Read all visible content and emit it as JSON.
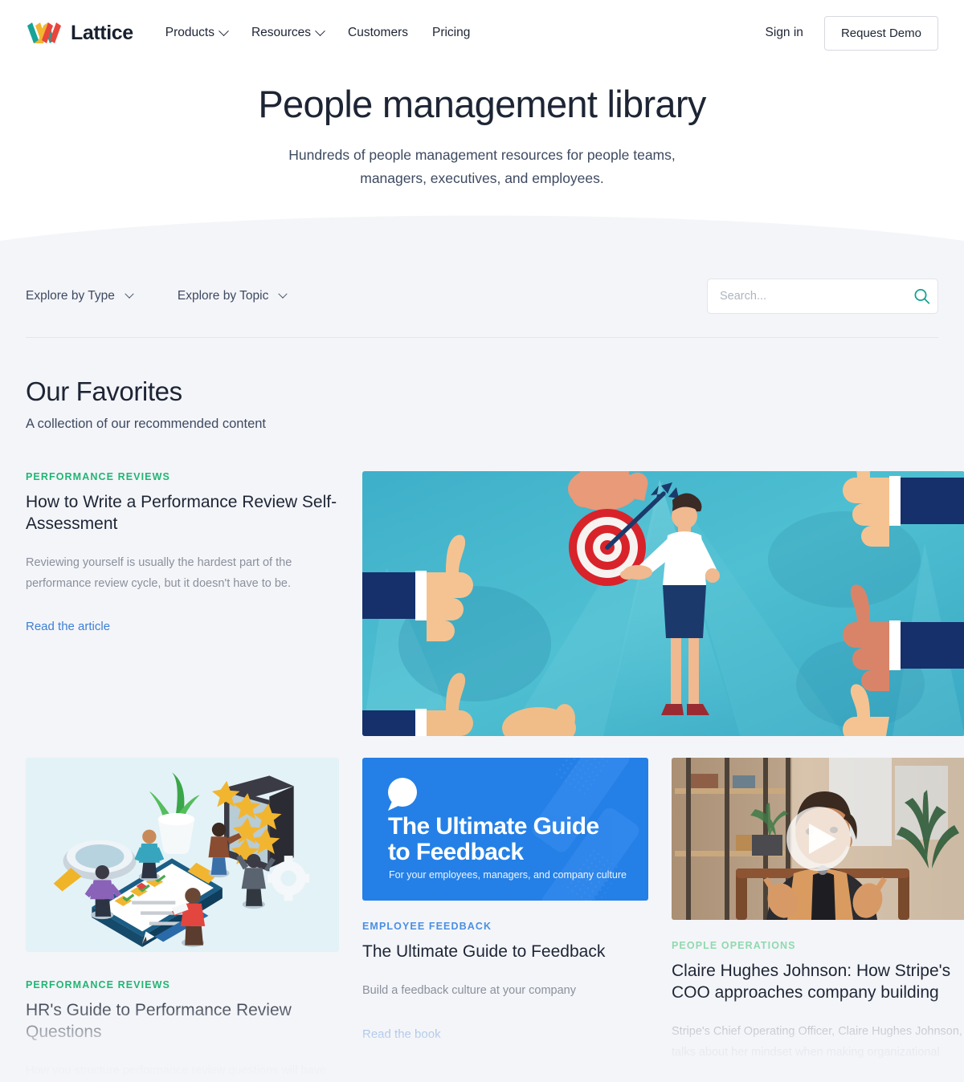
{
  "brand": {
    "name": "Lattice",
    "logo_icon": "lattice-logo-icon"
  },
  "nav": {
    "items": [
      {
        "label": "Products",
        "has_caret": true
      },
      {
        "label": "Resources",
        "has_caret": true
      },
      {
        "label": "Customers",
        "has_caret": false
      },
      {
        "label": "Pricing",
        "has_caret": false
      }
    ],
    "sign_in": "Sign in",
    "request_demo": "Request Demo"
  },
  "hero": {
    "title": "People management library",
    "subtitle": "Hundreds of people management resources for people teams, managers, executives, and employees."
  },
  "filters": {
    "type": {
      "label": "Explore by Type",
      "icon": "chevron-down-icon"
    },
    "topic": {
      "label": "Explore by Topic",
      "icon": "chevron-down-icon"
    }
  },
  "search": {
    "placeholder": "Search...",
    "value": "",
    "icon": "search-icon",
    "icon_color": "#16a293"
  },
  "section": {
    "title": "Our Favorites",
    "subtitle": "A collection of our recommended content"
  },
  "colors": {
    "page_background": "#f4f5f9",
    "header_background": "#ffffff",
    "text_primary": "#1d2535",
    "text_muted": "#8a909c",
    "link_blue": "#3d7fd4",
    "eyebrow_green": "#22b573",
    "eyebrow_blue": "#4a90e2",
    "eyebrow_mint": "#8fd9ae",
    "teal_accent": "#16a293",
    "book_card_blue": "#2480e6"
  },
  "cards": {
    "featured": {
      "eyebrow": "PERFORMANCE REVIEWS",
      "eyebrow_color": "#22b573",
      "title": "How to Write a Performance Review Self-Assessment",
      "description": "Reviewing yourself is usually the hardest part of the performance review cycle, but it doesn't have to be.",
      "link": "Read the article",
      "image_alt": "thumbs-up-target-illustration"
    },
    "hr_guide": {
      "eyebrow": "PERFORMANCE REVIEWS",
      "eyebrow_color": "#22b573",
      "title": "HR's Guide to Performance Review Questions",
      "description": "How you structure performance review questions will have",
      "image_alt": "isometric-review-illustration"
    },
    "feedback_book": {
      "eyebrow": "EMPLOYEE FEEDBACK",
      "eyebrow_color": "#4a90e2",
      "title": "The Ultimate Guide to Feedback",
      "description": "Build a feedback culture at your company",
      "link": "Read the book",
      "cover_title_line1": "The Ultimate Guide",
      "cover_title_line2": "to Feedback",
      "cover_subtitle": "For your employees, managers, and company culture",
      "cover_icon": "speech-bubble-icon"
    },
    "video": {
      "eyebrow": "PEOPLE OPERATIONS",
      "eyebrow_color": "#8fd9ae",
      "title": "Claire Hughes Johnson: How Stripe's COO approaches company building",
      "description": "Stripe's Chief Operating Officer, Claire Hughes Johnson, talks about her mindset when making organizational",
      "play_icon": "play-button-icon",
      "image_alt": "claire-hughes-johnson-video-thumbnail"
    }
  }
}
